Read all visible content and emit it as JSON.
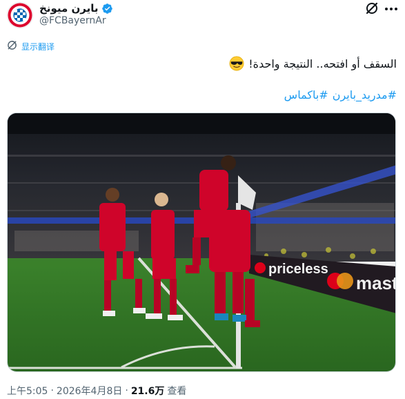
{
  "header": {
    "display_name": "بايرن ميونخ",
    "handle": "@FCBayernAr",
    "avatar": {
      "top_text": "FC BAYERN",
      "bottom_text": "MÜNCHEN",
      "colors": {
        "red": "#dc052d",
        "blue": "#0066b2",
        "white": "#ffffff"
      }
    },
    "verified": true,
    "icons": [
      "verified-icon",
      "grok-icon",
      "more-icon"
    ]
  },
  "translate": {
    "label": "显示翻译",
    "icon": "translate-icon"
  },
  "tweet": {
    "text": "السقف أو افتحه.. النتيجة واحدة!",
    "emoji": "sunglasses-face-emoji",
    "hashtags": [
      "#مدريد_بايرن",
      "#باكماس"
    ]
  },
  "media": {
    "type": "photo",
    "description_icon": "football-celebration-photo",
    "ad_board_text": "priceless",
    "ad_board_text_2": "mast"
  },
  "footer": {
    "time": "上午5:05",
    "separator": "·",
    "date": "2026年4月8日",
    "views_count": "21.6万",
    "views_label": "查看"
  },
  "colors": {
    "accent": "#1d9bf0",
    "text": "#0f1419",
    "muted": "#536471",
    "verified": "#1d9bf0"
  }
}
